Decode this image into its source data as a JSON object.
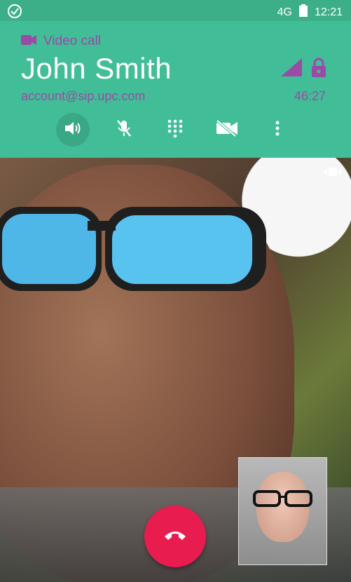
{
  "status_bar": {
    "network": "4G",
    "time": "12:21"
  },
  "call": {
    "type_label": "Video call",
    "name": "John Smith",
    "account": "account@sip.upc.com",
    "duration": "46:27"
  },
  "controls": {
    "speaker": {
      "icon": "speaker-icon",
      "active": true
    },
    "mute": {
      "icon": "mic-off-icon",
      "active": false
    },
    "dialpad": {
      "icon": "dialpad-icon",
      "active": false
    },
    "video_toggle": {
      "icon": "video-off-icon",
      "active": false
    },
    "more": {
      "icon": "more-vert-icon",
      "active": false
    }
  },
  "colors": {
    "header": "#41be97",
    "status_bar": "#3caf89",
    "accent_purple": "#9a4ba6",
    "hangup": "#e81c4f"
  }
}
